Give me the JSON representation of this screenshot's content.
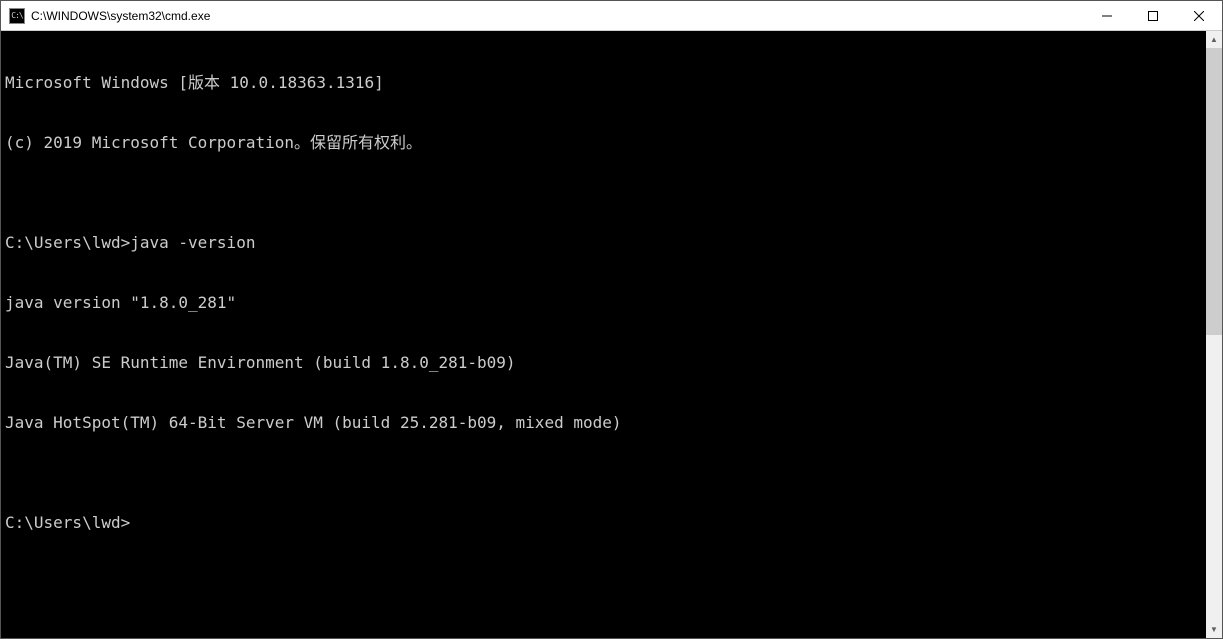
{
  "window": {
    "title": "C:\\WINDOWS\\system32\\cmd.exe",
    "icon_label": "C:\\"
  },
  "terminal": {
    "lines": [
      "Microsoft Windows [版本 10.0.18363.1316]",
      "(c) 2019 Microsoft Corporation。保留所有权利。",
      "",
      "C:\\Users\\lwd>java -version",
      "java version \"1.8.0_281\"",
      "Java(TM) SE Runtime Environment (build 1.8.0_281-b09)",
      "Java HotSpot(TM) 64-Bit Server VM (build 25.281-b09, mixed mode)",
      "",
      "C:\\Users\\lwd>"
    ]
  }
}
